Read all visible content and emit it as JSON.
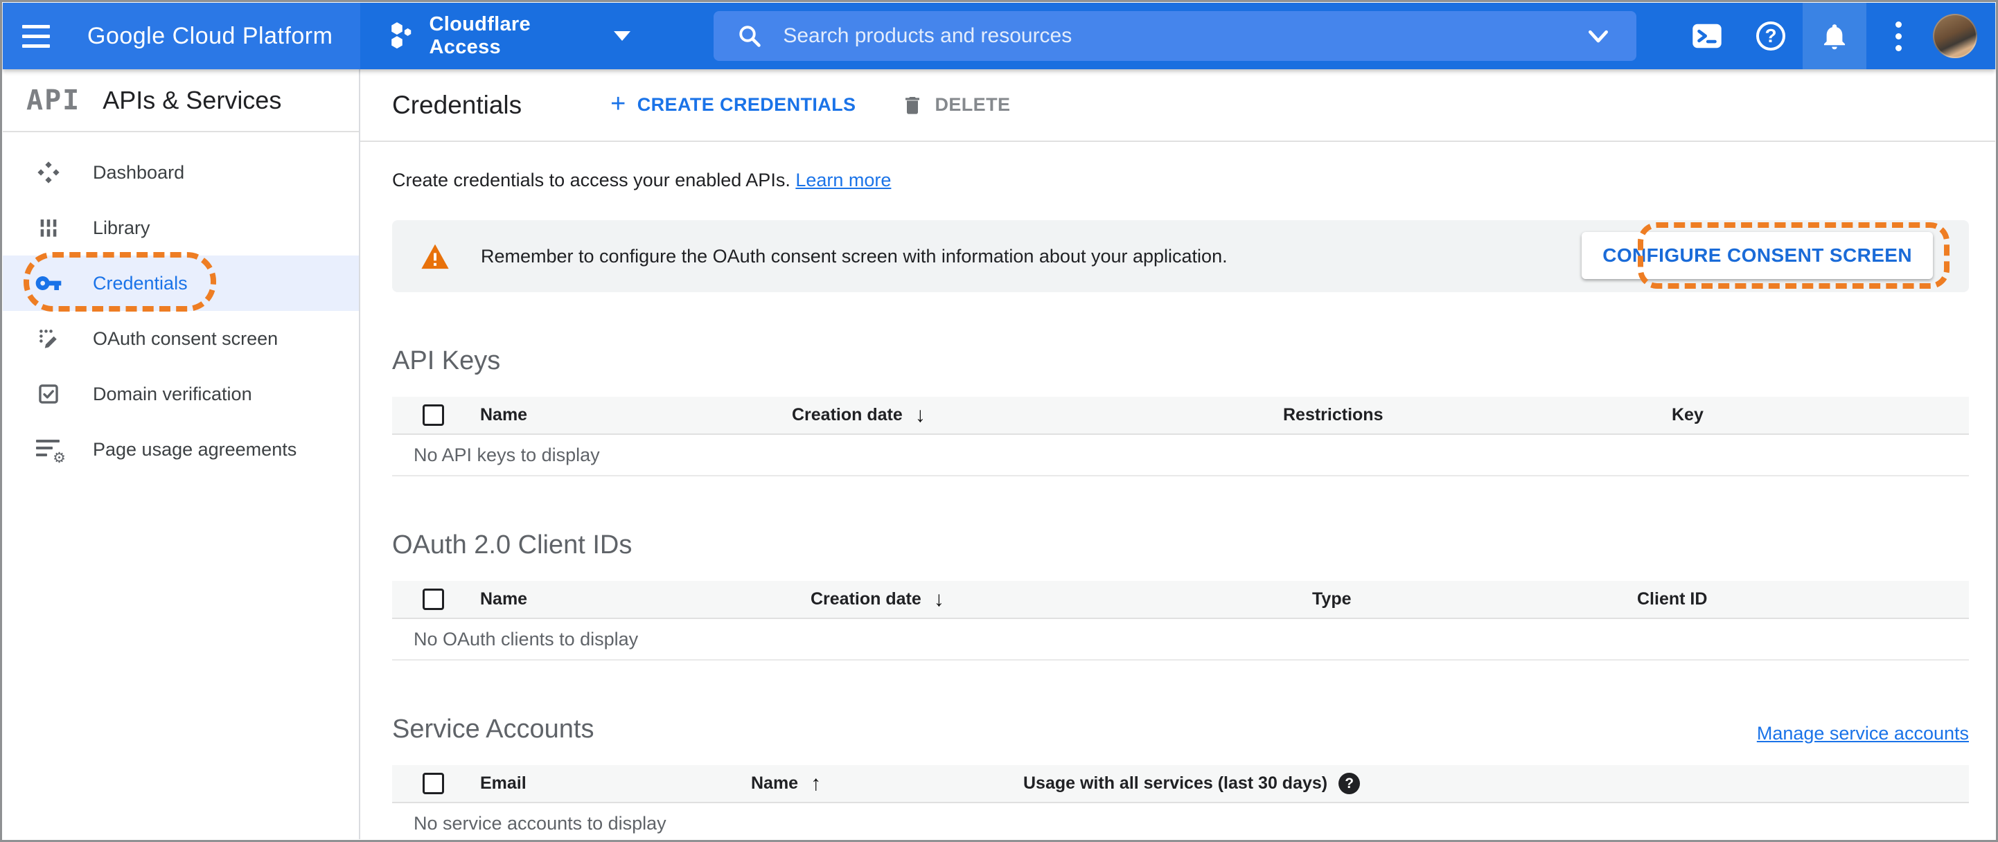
{
  "topbar": {
    "brand": "Google Cloud Platform",
    "project_name": "Cloudflare Access",
    "search_placeholder": "Search products and resources"
  },
  "sidebar": {
    "logo": "API",
    "title": "APIs & Services",
    "items": [
      {
        "label": "Dashboard"
      },
      {
        "label": "Library"
      },
      {
        "label": "Credentials",
        "active": true
      },
      {
        "label": "OAuth consent screen"
      },
      {
        "label": "Domain verification"
      },
      {
        "label": "Page usage agreements"
      }
    ]
  },
  "header": {
    "title": "Credentials",
    "create_label": "CREATE CREDENTIALS",
    "delete_label": "DELETE"
  },
  "intro": {
    "text": "Create credentials to access your enabled APIs.",
    "link_label": "Learn more"
  },
  "banner": {
    "message": "Remember to configure the OAuth consent screen with information about your application.",
    "button_label": "CONFIGURE CONSENT SCREEN"
  },
  "api_keys": {
    "title": "API Keys",
    "col_name": "Name",
    "col_creation": "Creation date",
    "col_restrictions": "Restrictions",
    "col_key": "Key",
    "sort_column": "Creation date",
    "sort_direction": "desc",
    "empty": "No API keys to display"
  },
  "oauth_clients": {
    "title": "OAuth 2.0 Client IDs",
    "col_name": "Name",
    "col_creation": "Creation date",
    "col_type": "Type",
    "col_client_id": "Client ID",
    "sort_column": "Creation date",
    "sort_direction": "desc",
    "empty": "No OAuth clients to display"
  },
  "service_accounts": {
    "title": "Service Accounts",
    "manage_link": "Manage service accounts",
    "col_email": "Email",
    "col_name": "Name",
    "col_usage": "Usage with all services (last 30 days)",
    "sort_column": "Name",
    "sort_direction": "asc",
    "empty": "No service accounts to display"
  },
  "glyphs": {
    "arrow_down": "↓",
    "arrow_up": "↑",
    "plus": "+",
    "question_mark": "?",
    "gear": "⚙"
  },
  "colors": {
    "topbar_blue": "#1a6fe0",
    "brand_section_blue": "#2b78e6",
    "search_box_blue": "#4585ec",
    "accent_blue": "#1a73e8",
    "selected_row_bg": "#e9effd",
    "annotation_orange": "#ee7d23",
    "warning_orange": "#e8710a",
    "banner_gray": "#f1f3f4"
  }
}
